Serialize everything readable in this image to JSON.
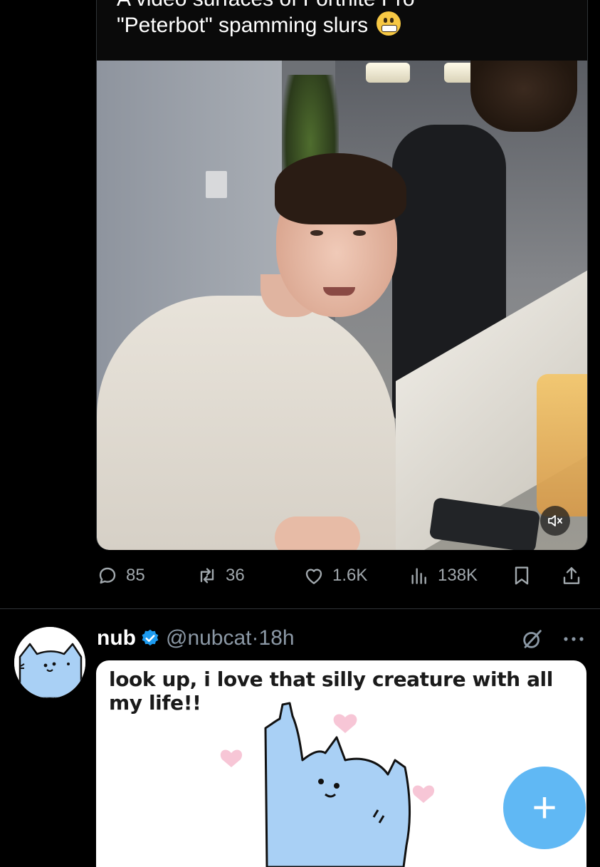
{
  "top_tweet": {
    "caption_line1": "A video surfaces of Fortnite Pro",
    "caption_line2": "\"Peterbot\" spamming slurs",
    "caption_emoji": "grimacing-face-emoji",
    "video_muted": true,
    "stats": {
      "replies": "85",
      "reposts": "36",
      "likes": "1.6K",
      "views": "138K"
    }
  },
  "second_tweet": {
    "display_name": "nub",
    "verified": true,
    "handle": "@nubcat",
    "separator": "·",
    "time": "18h",
    "embed_text": "look up, i love that silly creature with all my life!!"
  },
  "fab": {
    "label": "+"
  },
  "colors": {
    "background": "#000000",
    "accent": "#1d9bf0",
    "muted_text": "#8b98a5",
    "action_icons": "#a1a8ad",
    "cat_blue": "#a9d0f5",
    "heart_pink": "#f7c6d6"
  }
}
